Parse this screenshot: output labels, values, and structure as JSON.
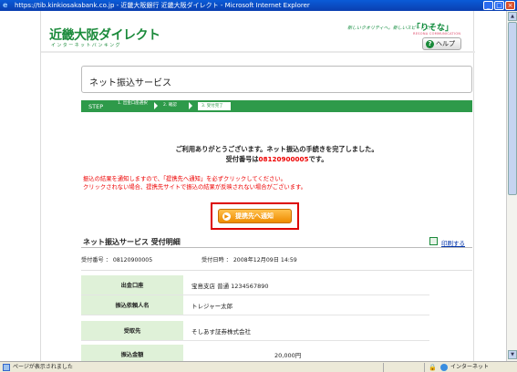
{
  "window": {
    "title": "https://tib.kinkiosakabank.co.jp - 近畿大阪銀行 近畿大阪ダイレクト - Microsoft Internet Explorer",
    "minimize": "_",
    "maximize": "□",
    "close": "×"
  },
  "header": {
    "logo": "近畿大阪ダイレクト",
    "logo_sub": "インターネットバンキング",
    "slogan": "新しいクオリティへ。新しいスピードで。",
    "group_logo": "「りそな」",
    "group_sub": "RESONA COMMUNICATION",
    "help_label": "ヘルプ"
  },
  "service": {
    "title": "ネット振込サービス"
  },
  "steps": {
    "label": "STEP",
    "items": [
      "1. 出金口座選択",
      "2. 確認",
      "3. 受付完了"
    ],
    "current": 3
  },
  "completion": {
    "line1": "ご利用ありがとうございます。ネット振込の手続きを完了しました。",
    "line2_prefix": "受付番号は",
    "reference_number": "08120900005",
    "line2_suffix": "です。"
  },
  "notice": {
    "line1": "振込の結果を通知しますので、「提携先へ通知」を必ずクリックしてください。",
    "line2": "クリックされない場合、提携先サイトで振込の結果が反映されない場合がございます。"
  },
  "notify_button": {
    "label": "提携先へ通知"
  },
  "receipt": {
    "title": "ネット振込サービス 受付明細",
    "print_label": "印刷する",
    "reference_label": "受付番号 ： 08120900005",
    "datetime_label": "受付日時 ： 2008年12月09日 14:59",
    "rows": [
      {
        "label": "出金口座",
        "value": "宝島支店 普通 1234567890"
      },
      {
        "label": "振込依頼人名",
        "value": "トレジャー太郎"
      },
      {
        "label": "受取先",
        "value": "そしあす証券株式会社"
      },
      {
        "label": "振込金額",
        "value": "20,000円"
      }
    ]
  },
  "statusbar": {
    "status": "ページが表示されました",
    "zone": "インターネット"
  }
}
